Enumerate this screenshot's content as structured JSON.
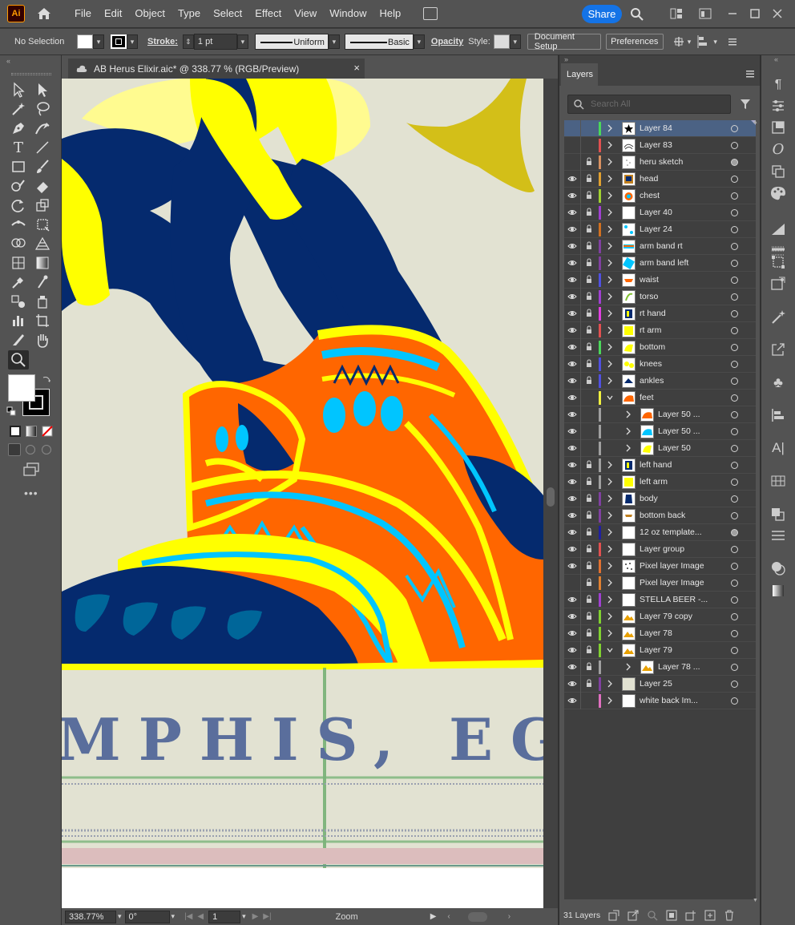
{
  "app": {
    "logo": "Ai"
  },
  "menu": [
    "File",
    "Edit",
    "Object",
    "Type",
    "Select",
    "Effect",
    "View",
    "Window",
    "Help"
  ],
  "share_label": "Share",
  "control_bar": {
    "selection": "No Selection",
    "stroke_label": "Stroke:",
    "stroke_weight": "1 pt",
    "profile": "Uniform",
    "brush": "Basic",
    "opacity_label": "Opacity",
    "style_label": "Style:",
    "document_setup": "Document Setup",
    "preferences": "Preferences"
  },
  "document": {
    "tab_title": "AB Herus Elixir.aic* @ 338.77 % (RGB/Preview)",
    "close": "×"
  },
  "artwork": {
    "text": "MPHIS, EGYPT"
  },
  "status": {
    "zoom": "338.77%",
    "rotation": "0°",
    "artboard": "1",
    "tool": "Zoom"
  },
  "layers_panel": {
    "title": "Layers",
    "search_placeholder": "Search All",
    "footer_count": "31 Layers",
    "colors": {
      "selected_row": "#4b6284"
    },
    "layers": [
      {
        "name": "Layer 84",
        "color": "#4bd65a",
        "eye": false,
        "lock": false,
        "indent": 0,
        "chev": "right",
        "thumb": "black-flower",
        "selected": true,
        "target": "ring"
      },
      {
        "name": "Layer 83",
        "color": "#e05050",
        "eye": false,
        "lock": false,
        "indent": 0,
        "chev": "right",
        "thumb": "sketch",
        "target": "ring"
      },
      {
        "name": "heru sketch",
        "color": "#d89060",
        "eye": false,
        "lock": true,
        "indent": 0,
        "chev": "right",
        "thumb": "dots",
        "target": "filled"
      },
      {
        "name": "head",
        "color": "#e0a030",
        "eye": true,
        "lock": true,
        "indent": 0,
        "chev": "right",
        "thumb": "head",
        "target": "ring"
      },
      {
        "name": "chest",
        "color": "#a0d030",
        "eye": true,
        "lock": true,
        "indent": 0,
        "chev": "right",
        "thumb": "chest",
        "target": "ring"
      },
      {
        "name": "Layer 40",
        "color": "#a040d0",
        "eye": true,
        "lock": true,
        "indent": 0,
        "chev": "right",
        "thumb": "blank",
        "target": "ring"
      },
      {
        "name": "Layer 24",
        "color": "#d07020",
        "eye": true,
        "lock": true,
        "indent": 0,
        "chev": "right",
        "thumb": "cyan-dots",
        "target": "ring"
      },
      {
        "name": "arm band rt",
        "color": "#8040a0",
        "eye": true,
        "lock": true,
        "indent": 0,
        "chev": "right",
        "thumb": "band",
        "target": "ring"
      },
      {
        "name": "arm band left",
        "color": "#8040a0",
        "eye": true,
        "lock": true,
        "indent": 0,
        "chev": "right",
        "thumb": "band2",
        "target": "ring"
      },
      {
        "name": "waist",
        "color": "#5050e0",
        "eye": true,
        "lock": true,
        "indent": 0,
        "chev": "right",
        "thumb": "waist",
        "target": "ring"
      },
      {
        "name": "torso",
        "color": "#a040d0",
        "eye": true,
        "lock": true,
        "indent": 0,
        "chev": "right",
        "thumb": "torso",
        "target": "ring"
      },
      {
        "name": "rt hand",
        "color": "#e040e0",
        "eye": true,
        "lock": true,
        "indent": 0,
        "chev": "right",
        "thumb": "hand",
        "target": "ring"
      },
      {
        "name": "rt arm",
        "color": "#e05050",
        "eye": true,
        "lock": true,
        "indent": 0,
        "chev": "right",
        "thumb": "yellow",
        "target": "ring"
      },
      {
        "name": "bottom",
        "color": "#4bd65a",
        "eye": true,
        "lock": true,
        "indent": 0,
        "chev": "right",
        "thumb": "yellow-shape",
        "target": "ring"
      },
      {
        "name": "knees",
        "color": "#5050e0",
        "eye": true,
        "lock": true,
        "indent": 0,
        "chev": "right",
        "thumb": "knees",
        "target": "ring"
      },
      {
        "name": "ankles",
        "color": "#5050e0",
        "eye": true,
        "lock": true,
        "indent": 0,
        "chev": "right",
        "thumb": "ankles",
        "target": "ring"
      },
      {
        "name": "feet",
        "color": "#f0f040",
        "eye": true,
        "lock": false,
        "indent": 0,
        "chev": "down",
        "thumb": "orange",
        "target": "ring"
      },
      {
        "name": "Layer 50 ...",
        "color": "#a0a0a0",
        "eye": true,
        "lock": false,
        "indent": 1,
        "chev": "right",
        "thumb": "orange",
        "target": "ring"
      },
      {
        "name": "Layer 50 ...",
        "color": "#a0a0a0",
        "eye": true,
        "lock": false,
        "indent": 1,
        "chev": "right",
        "thumb": "cyan",
        "target": "ring"
      },
      {
        "name": "Layer 50",
        "color": "#a0a0a0",
        "eye": true,
        "lock": false,
        "indent": 1,
        "chev": "right",
        "thumb": "yellow-shape",
        "target": "ring"
      },
      {
        "name": "left hand",
        "color": "#a0a0a0",
        "eye": true,
        "lock": true,
        "indent": 0,
        "chev": "right",
        "thumb": "hand",
        "target": "ring"
      },
      {
        "name": "left arm",
        "color": "#a0a0a0",
        "eye": true,
        "lock": true,
        "indent": 0,
        "chev": "right",
        "thumb": "yellow",
        "target": "ring"
      },
      {
        "name": "body",
        "color": "#8040a0",
        "eye": true,
        "lock": true,
        "indent": 0,
        "chev": "right",
        "thumb": "body",
        "target": "ring"
      },
      {
        "name": "bottom back",
        "color": "#8040a0",
        "eye": true,
        "lock": true,
        "indent": 0,
        "chev": "right",
        "thumb": "bb",
        "target": "ring"
      },
      {
        "name": "12 oz template...",
        "color": "#2020a0",
        "eye": true,
        "lock": true,
        "indent": 0,
        "chev": "right",
        "thumb": "blank",
        "target": "filled"
      },
      {
        "name": "Layer group",
        "color": "#e05050",
        "eye": true,
        "lock": true,
        "indent": 0,
        "chev": "right",
        "thumb": "blank",
        "target": "ring"
      },
      {
        "name": "Pixel layer Image",
        "color": "#e07030",
        "eye": true,
        "lock": true,
        "indent": 0,
        "chev": "right",
        "thumb": "pixel",
        "target": "ring"
      },
      {
        "name": "Pixel layer Image",
        "color": "#e08030",
        "eye": false,
        "lock": true,
        "indent": 0,
        "chev": "right",
        "thumb": "blank",
        "target": "ring"
      },
      {
        "name": "STELLA BEER -...",
        "color": "#a040d0",
        "eye": true,
        "lock": true,
        "indent": 0,
        "chev": "right",
        "thumb": "blank",
        "target": "ring"
      },
      {
        "name": "Layer 79 copy",
        "color": "#80d030",
        "eye": true,
        "lock": true,
        "indent": 0,
        "chev": "right",
        "thumb": "mountain",
        "target": "ring"
      },
      {
        "name": "Layer 78",
        "color": "#80d030",
        "eye": true,
        "lock": true,
        "indent": 0,
        "chev": "right",
        "thumb": "mountain",
        "target": "ring"
      },
      {
        "name": "Layer 79",
        "color": "#80d030",
        "eye": true,
        "lock": true,
        "indent": 0,
        "chev": "down",
        "thumb": "mountain",
        "target": "ring"
      },
      {
        "name": "Layer 78 ...",
        "color": "#a0a0a0",
        "eye": true,
        "lock": true,
        "indent": 1,
        "chev": "right",
        "thumb": "mountain",
        "target": "ring"
      },
      {
        "name": "Layer 25",
        "color": "#8040a0",
        "eye": true,
        "lock": true,
        "indent": 0,
        "chev": "right",
        "thumb": "beige",
        "target": "ring"
      },
      {
        "name": "white back Im...",
        "color": "#e070c0",
        "eye": true,
        "lock": false,
        "indent": 0,
        "chev": "right",
        "thumb": "blank",
        "target": "ring"
      }
    ]
  }
}
